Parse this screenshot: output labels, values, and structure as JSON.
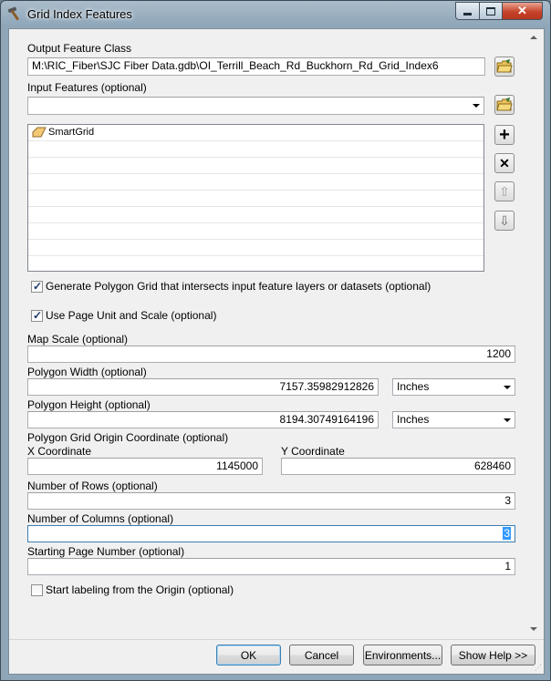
{
  "window": {
    "title": "Grid Index Features"
  },
  "output_feature_class": {
    "label": "Output Feature Class",
    "value": "M:\\RIC_Fiber\\SJC Fiber Data.gdb\\OI_Terrill_Beach_Rd_Buckhorn_Rd_Grid_Index6"
  },
  "input_features": {
    "label": "Input Features (optional)",
    "value": "",
    "items": [
      {
        "name": "SmartGrid"
      }
    ]
  },
  "checkboxes": {
    "generate_polygon_grid": {
      "label": "Generate Polygon Grid that intersects input feature layers or datasets (optional)",
      "checked": true
    },
    "use_page_unit": {
      "label": "Use Page Unit and Scale (optional)",
      "checked": true
    },
    "start_from_origin": {
      "label": "Start labeling from the Origin (optional)",
      "checked": false
    }
  },
  "map_scale": {
    "label": "Map Scale (optional)",
    "value": "1200"
  },
  "polygon_width": {
    "label": "Polygon Width (optional)",
    "value": "7157.35982912826",
    "unit": "Inches"
  },
  "polygon_height": {
    "label": "Polygon Height (optional)",
    "value": "8194.30749164196",
    "unit": "Inches"
  },
  "origin": {
    "label": "Polygon Grid Origin Coordinate (optional)",
    "x_label": "X Coordinate",
    "x_value": "1145000",
    "y_label": "Y Coordinate",
    "y_value": "628460"
  },
  "rows": {
    "label": "Number of Rows (optional)",
    "value": "3"
  },
  "columns": {
    "label": "Number of Columns (optional)",
    "value": "3"
  },
  "start_page": {
    "label": "Starting Page Number (optional)",
    "value": "1"
  },
  "buttons": {
    "ok": "OK",
    "cancel": "Cancel",
    "environments": "Environments...",
    "show_help": "Show Help >>"
  },
  "icons": [
    "open-folder-icon",
    "add-icon",
    "remove-icon",
    "move-up-icon",
    "move-down-icon",
    "polygon-layer-icon",
    "hammer-icon"
  ]
}
